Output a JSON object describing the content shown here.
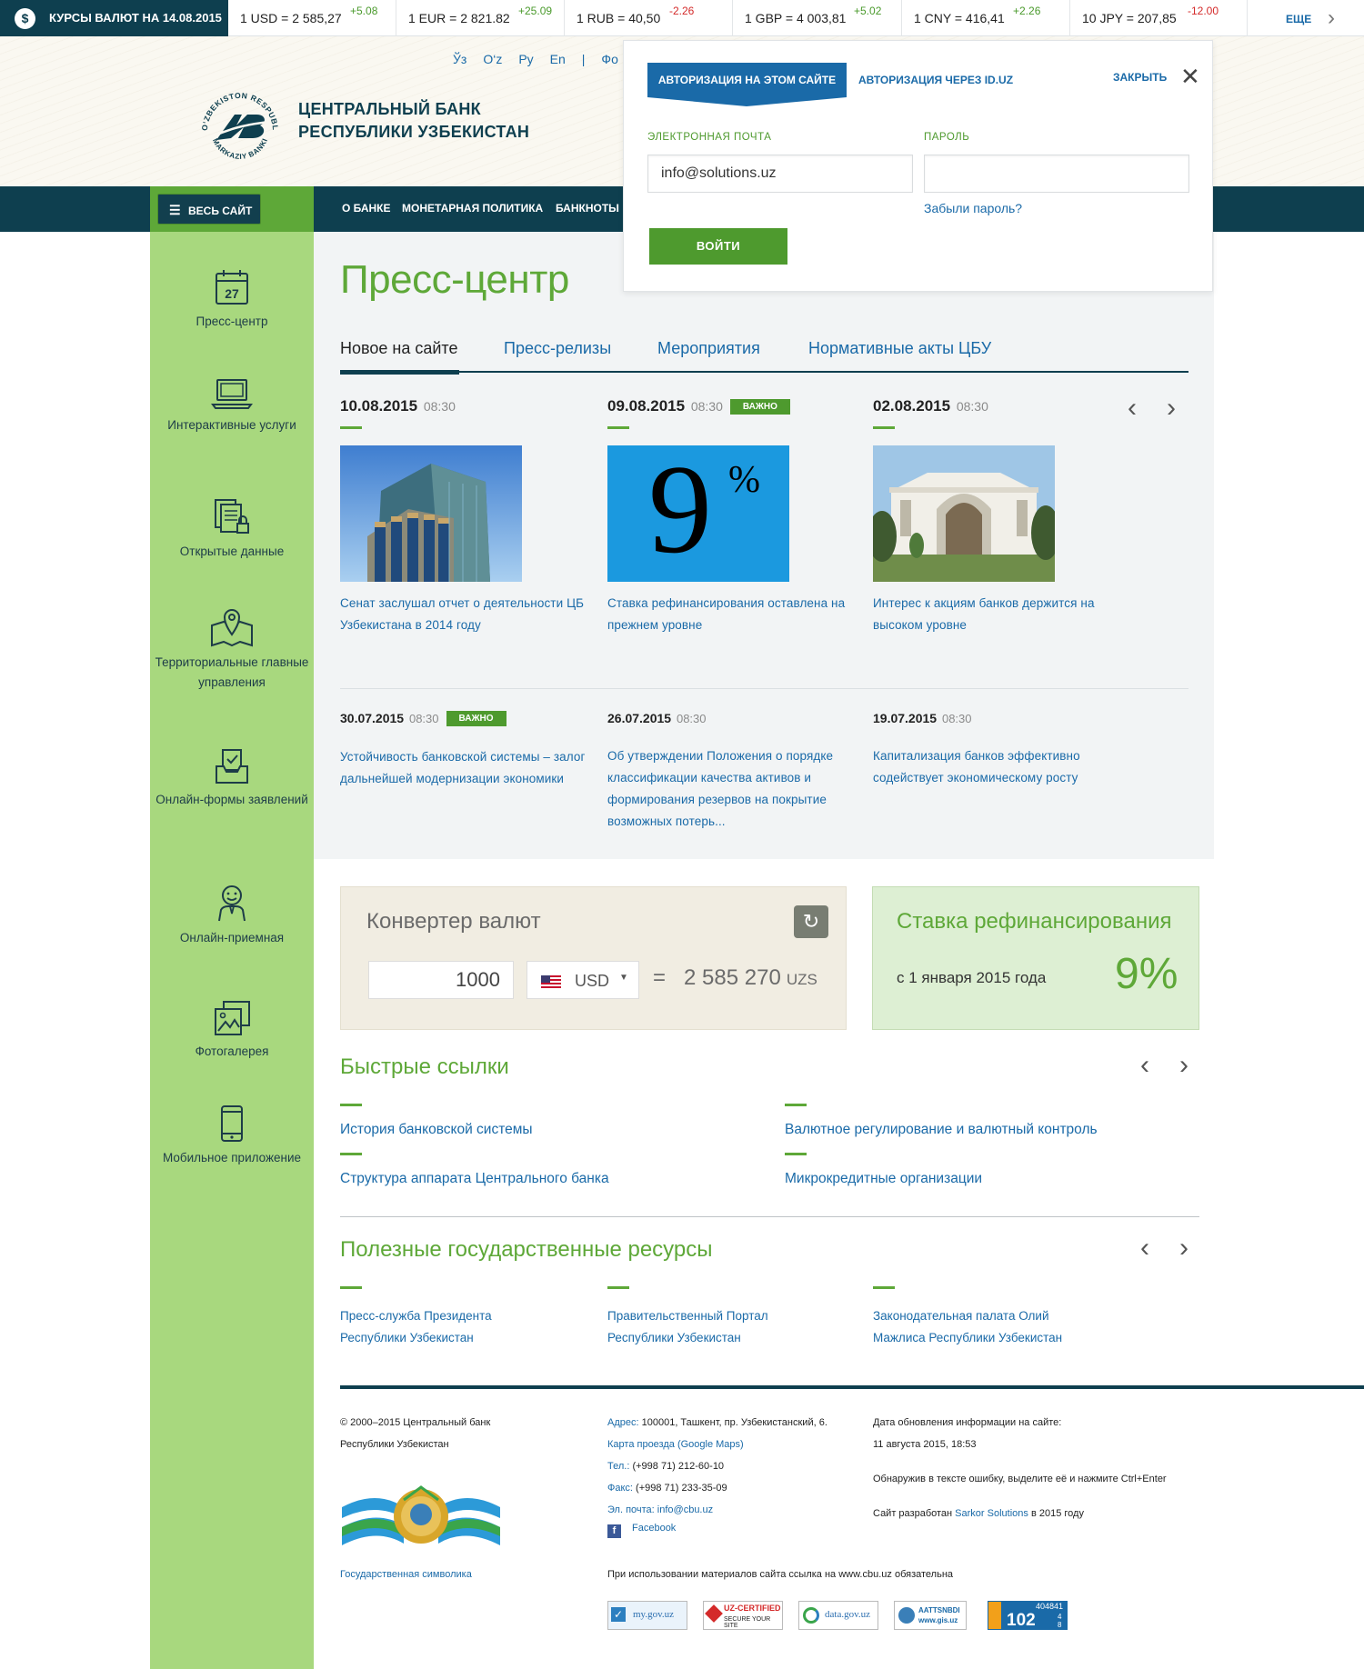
{
  "ticker": {
    "title": "КУРСЫ ВАЛЮТ НА 14.08.2015",
    "rates": [
      {
        "value": "1 USD = 2 585,27",
        "delta": "+5.08",
        "dir": "up"
      },
      {
        "value": "1 EUR = 2 821.82",
        "delta": "+25.09",
        "dir": "up"
      },
      {
        "value": "1 RUB = 40,50",
        "delta": "-2.26",
        "dir": "dn"
      },
      {
        "value": "1 GBP = 4 003,81",
        "delta": "+5.02",
        "dir": "up"
      },
      {
        "value": "1 CNY = 416,41",
        "delta": "+2.26",
        "dir": "up"
      },
      {
        "value": "10 JPY = 207,85",
        "delta": "-12.00",
        "dir": "dn"
      }
    ],
    "more": "ЕЩЕ"
  },
  "header": {
    "langs": [
      "Ўз",
      "O‘z",
      "Ру",
      "En",
      "|",
      "Фо"
    ],
    "bank_name_1": "ЦЕНТРАЛЬНЫЙ БАНК",
    "bank_name_2": "РЕСПУБЛИКИ УЗБЕКИСТАН",
    "logo_text": "O‘ZBEKISTON RESPUBLIKASI MARKAZIY BANKI"
  },
  "nav": {
    "site_btn": "ВЕСЬ САЙТ",
    "links": [
      "О БАНКЕ",
      "МОНЕТАРНАЯ ПОЛИТИКА",
      "БАНКНОТЫ"
    ]
  },
  "sidebar": {
    "items": [
      {
        "label": "Пресс-центр",
        "icon": "calendar-icon",
        "cal_num": "27"
      },
      {
        "label": "Интерактивные услуги",
        "icon": "laptop-icon"
      },
      {
        "label": "Открытые данные",
        "icon": "documents-lock-icon"
      },
      {
        "label": "Территориальные главные управления",
        "icon": "map-pin-icon"
      },
      {
        "label": "Онлайн-формы заявлений",
        "icon": "form-tray-icon"
      },
      {
        "label": "Онлайн-приемная",
        "icon": "person-icon"
      },
      {
        "label": "Фотогалерея",
        "icon": "photo-gallery-icon"
      },
      {
        "label": "Мобильное приложение",
        "icon": "mobile-icon"
      }
    ]
  },
  "press": {
    "title": "Пресс-центр",
    "tabs": [
      "Новое на сайте",
      "Пресс-релизы",
      "Мероприятия",
      "Нормативные акты ЦБУ"
    ],
    "badge": "ВАЖНО",
    "featured": [
      {
        "date": "10.08.2015",
        "time": "08:30",
        "title": "Сенат заслушал отчет о деятельности ЦБ Узбекистана в 2014 году",
        "important": false
      },
      {
        "date": "09.08.2015",
        "time": "08:30",
        "title": "Ставка рефинансирования оставлена на прежнем уровне",
        "important": true,
        "img_text": "9",
        "img_sup": "%"
      },
      {
        "date": "02.08.2015",
        "time": "08:30",
        "title": "Интерес к акциям банков держится на высоком уровне",
        "important": false
      }
    ],
    "secondary": [
      {
        "date": "30.07.2015",
        "time": "08:30",
        "title": "Устойчивость банковской системы – залог дальнейшей модернизации экономики",
        "important": true
      },
      {
        "date": "26.07.2015",
        "time": "08:30",
        "title": "Об утверждении Положения о порядке классификации качества активов и формирования резервов на покрытие возможных потерь...",
        "important": false
      },
      {
        "date": "19.07.2015",
        "time": "08:30",
        "title": "Капитализация банков эффективно содействует экономическому росту",
        "important": false
      }
    ]
  },
  "auth": {
    "tab_site": "АВТОРИЗАЦИЯ НА ЭТОМ САЙТЕ",
    "tab_iduz": "АВТОРИЗАЦИЯ ЧЕРЕЗ ID.UZ",
    "close": "ЗАКРЫТЬ",
    "email_label": "ЭЛЕКТРОННАЯ ПОЧТА",
    "email_value": "info@solutions.uz",
    "password_label": "ПАРОЛЬ",
    "password_value": "",
    "forgot": "Забыли пароль?",
    "login": "ВОЙТИ"
  },
  "converter": {
    "title": "Конвертер валют",
    "amount": "1000",
    "currency": "USD",
    "equals": "=",
    "result": "2 585 270",
    "result_currency": "UZS"
  },
  "refinancing": {
    "title": "Ставка рефинансирования",
    "since": "с 1 января 2015 года",
    "value": "9%"
  },
  "quick_links": {
    "title": "Быстрые ссылки",
    "links": [
      "История банковской системы",
      "Валютное регулирование и валютный контроль",
      "Структура аппарата Центрального банка",
      "Микрокредитные организации"
    ]
  },
  "gov_resources": {
    "title": "Полезные государственные ресурсы",
    "links": [
      "Пресс-служба Президента Республики Узбекистан",
      "Правительственный Портал Республики Узбекистан",
      "Законодательная палата Олий Мажлиса Республики Узбекистан"
    ]
  },
  "footer": {
    "copyright_1": "© 2000–2015 Центральный банк",
    "copyright_2": "Республики Узбекистан",
    "symbols": "Государственная символика",
    "address_k": "Адрес:",
    "address": "100001, Ташкент, пр. Узбекистанский, 6.",
    "map": "Карта проезда (Google Maps)",
    "phone_k": "Тел.:",
    "phone": "(+998 71) 212-60-10",
    "fax_k": "Факс:",
    "fax": "(+998 71) 233-35-09",
    "email_k": "Эл. почта:",
    "email": "info@cbu.uz",
    "facebook": "Facebook",
    "updated_1": "Дата обновления информации на сайте:",
    "updated_2": "11 августа 2015, 18:53",
    "error_note": "Обнаружив в тексте ошибку, выделите её и нажмите Ctrl+Enter",
    "dev_pre": "Сайт разработан",
    "dev_name": "Sarkor Solutions",
    "dev_post": "в 2015 году",
    "usage": "При использовании материалов сайта ссылка на www.cbu.uz обязательна",
    "banners": [
      "my.gov.uz",
      "UZ-CERTIFIED",
      "data.gov.uz",
      "AATTSNBDI www.gis.uz",
      "102"
    ],
    "banner_cert_sub": "SECURE YOUR SITE",
    "counter_top": "404841",
    "counter_side": [
      "4",
      "8"
    ]
  },
  "colors": {
    "dark": "#0e3f4f",
    "green": "#5ea838",
    "sidebar": "#a8d87e",
    "link": "#1a6aa8",
    "red": "#d42a2a"
  }
}
